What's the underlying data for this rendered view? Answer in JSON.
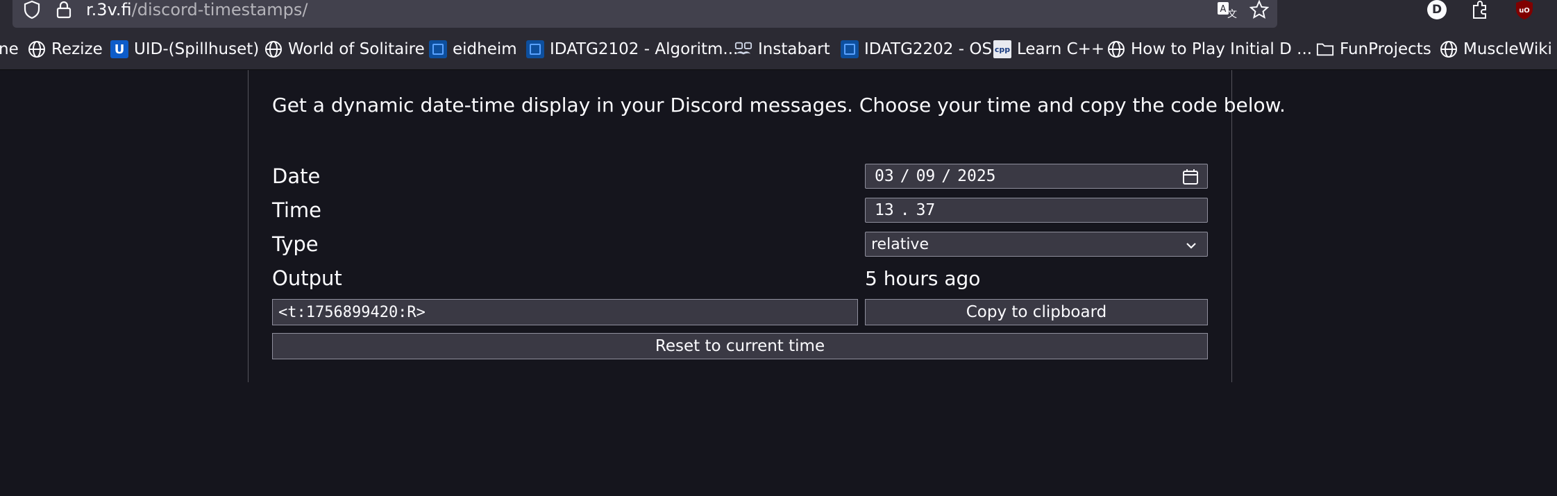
{
  "browser": {
    "url_host": "r.3v.fi",
    "url_path": "/discord-timestamps/",
    "profile_initial": "D",
    "ublock_label": "uO"
  },
  "bookmarks": [
    {
      "label": "ne",
      "icon": "partial"
    },
    {
      "label": "Rezize",
      "icon": "globe-icon"
    },
    {
      "label": "UID-(Spillhuset)",
      "icon": "u-logo-icon"
    },
    {
      "label": "World of Solitaire",
      "icon": "globe-icon"
    },
    {
      "label": "eidheim",
      "icon": "blue-square-icon"
    },
    {
      "label": "IDATG2102 - Algoritm...",
      "icon": "blue-square-icon"
    },
    {
      "label": "Instabart",
      "icon": "mustache-icon"
    },
    {
      "label": "IDATG2202 - OS",
      "icon": "blue-square-icon"
    },
    {
      "label": "Learn C++",
      "icon": "cpp-icon"
    },
    {
      "label": "How to Play Initial D ...",
      "icon": "globe-icon"
    },
    {
      "label": "FunProjects",
      "icon": "folder-icon"
    },
    {
      "label": "MuscleWiki",
      "icon": "globe-icon"
    }
  ],
  "page": {
    "intro": "Get a dynamic date-time display in your Discord messages. Choose your time and copy the code below.",
    "labels": {
      "date": "Date",
      "time": "Time",
      "type": "Type",
      "output": "Output"
    },
    "date": {
      "day": "03",
      "month": "09",
      "year": "2025",
      "sep": "/"
    },
    "time": {
      "hours": "13",
      "minutes": "37",
      "sep": "."
    },
    "type_selected": "relative",
    "output_text": "5 hours ago",
    "code": "<t:1756899420:R>",
    "copy_button": "Copy to clipboard",
    "reset_button": "Reset to current time"
  },
  "colors": {
    "page_bg": "#15151d",
    "chrome_bg": "#2b2a33",
    "field_bg": "#3a3944",
    "ublock_red": "#800000"
  }
}
